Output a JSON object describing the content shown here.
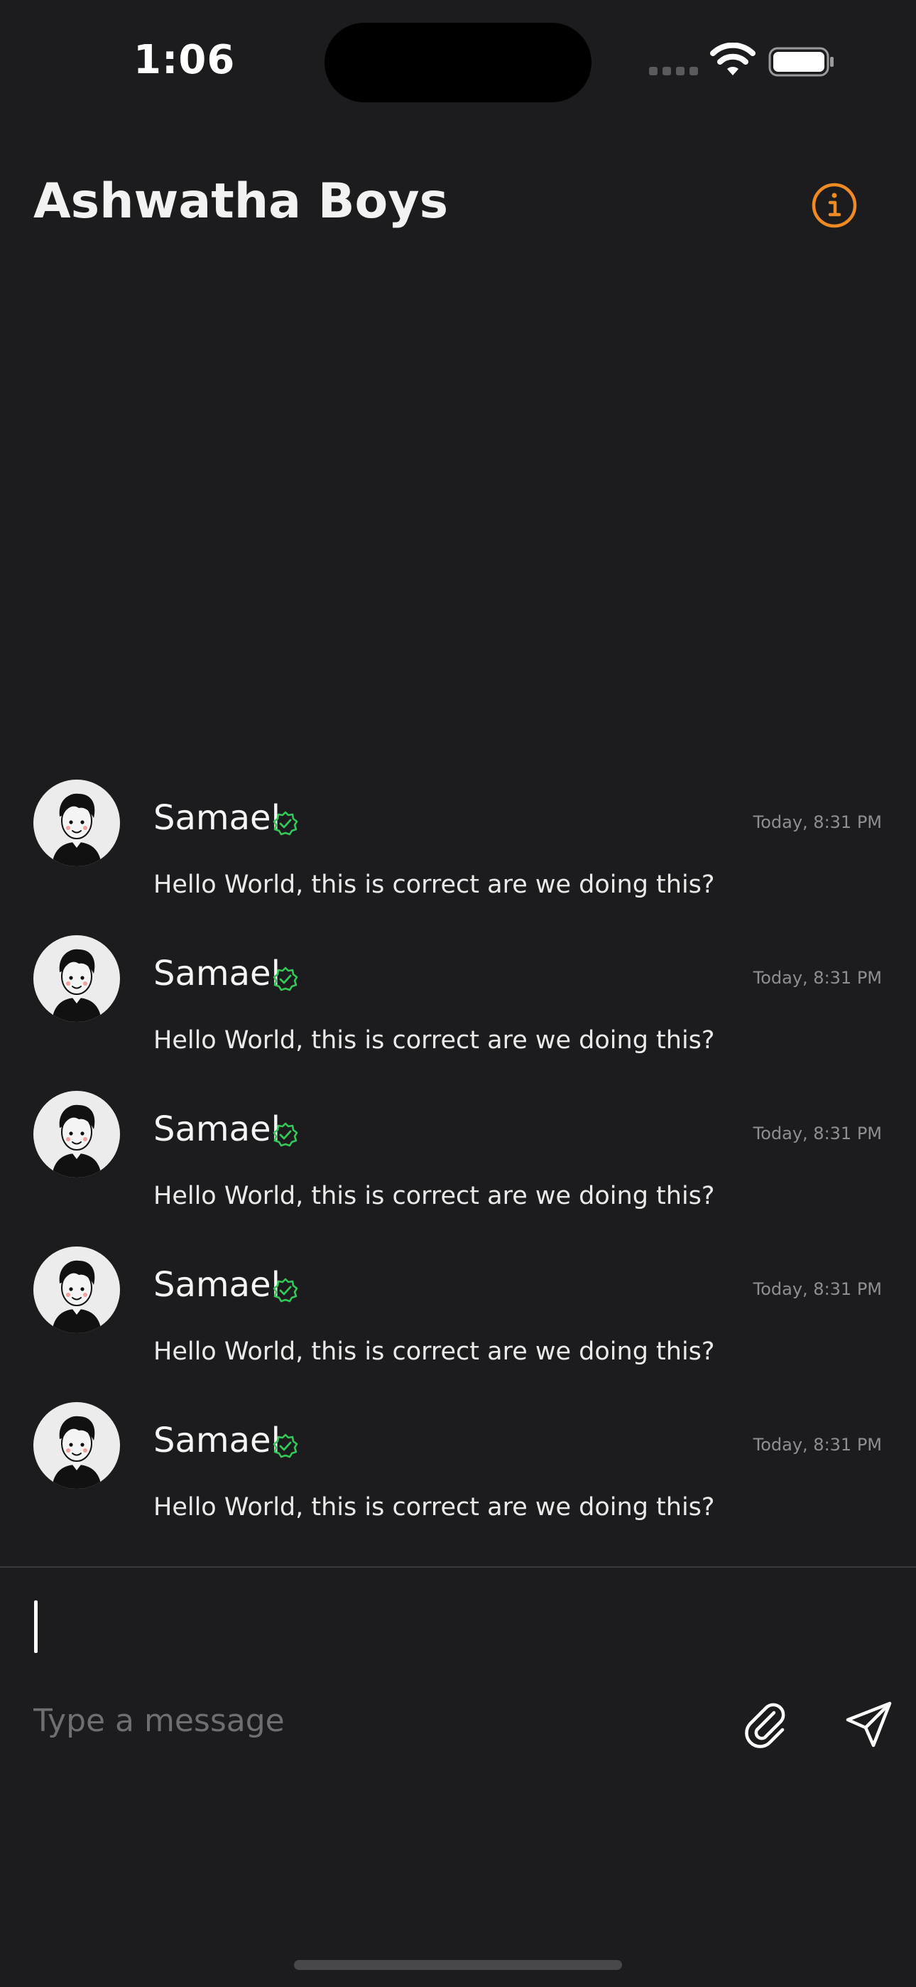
{
  "status_bar": {
    "time": "1:06",
    "icons": [
      "signal-icon",
      "wifi-icon",
      "battery-icon"
    ]
  },
  "header": {
    "title": "Ashwatha Boys",
    "info_icon": "info-icon",
    "accent_color": "#f08a24"
  },
  "messages": [
    {
      "sender": "Samael",
      "verified": true,
      "timestamp": "Today, 8:31 PM",
      "text": "Hello World, this is correct are we doing this?"
    },
    {
      "sender": "Samael",
      "verified": true,
      "timestamp": "Today, 8:31 PM",
      "text": "Hello World, this is correct are we doing this?"
    },
    {
      "sender": "Samael",
      "verified": true,
      "timestamp": "Today, 8:31 PM",
      "text": "Hello World, this is correct are we doing this?"
    },
    {
      "sender": "Samael",
      "verified": true,
      "timestamp": "Today, 8:31 PM",
      "text": "Hello World, this is correct are we doing this?"
    },
    {
      "sender": "Samael",
      "verified": true,
      "timestamp": "Today, 8:31 PM",
      "text": "Hello World, this is correct are we doing this?"
    }
  ],
  "composer": {
    "value": "",
    "placeholder": "Type a message",
    "attach_icon": "paperclip-icon",
    "send_icon": "send-icon"
  },
  "colors": {
    "background": "#1c1c1e",
    "verified": "#34c759",
    "timestamp": "#8e8e93"
  }
}
